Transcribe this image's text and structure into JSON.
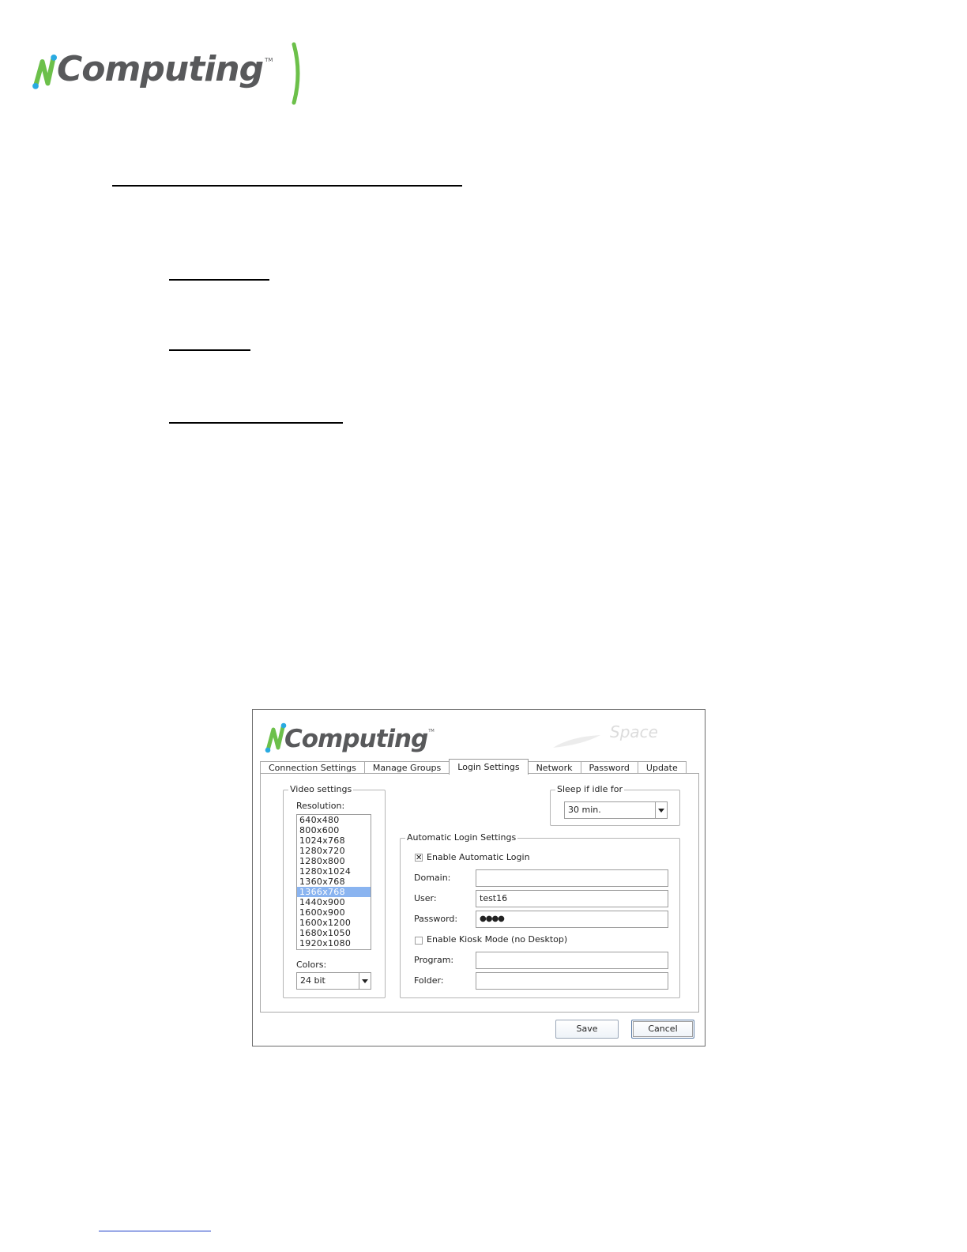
{
  "header": {
    "logo_text": "Computing",
    "logo_tm": "TM"
  },
  "dialog": {
    "logo_text": "Computing",
    "logo_tm": "TM",
    "watermark": "Space",
    "tabs": [
      {
        "label": "Connection Settings",
        "active": false
      },
      {
        "label": "Manage Groups",
        "active": false
      },
      {
        "label": "Login Settings",
        "active": true
      },
      {
        "label": "Network",
        "active": false
      },
      {
        "label": "Password",
        "active": false
      },
      {
        "label": "Update",
        "active": false
      }
    ],
    "video_settings": {
      "title": "Video settings",
      "resolution_label": "Resolution:",
      "resolutions": [
        "640x480",
        "800x600",
        "1024x768",
        "1280x720",
        "1280x800",
        "1280x1024",
        "1360x768",
        "1366x768",
        "1440x900",
        "1600x900",
        "1600x1200",
        "1680x1050",
        "1920x1080"
      ],
      "selected_resolution": "1366x768",
      "colors_label": "Colors:",
      "colors_value": "24 bit"
    },
    "sleep": {
      "title": "Sleep if idle for",
      "value": "30 min."
    },
    "auto_login": {
      "title": "Automatic Login Settings",
      "enable_label": "Enable Automatic Login",
      "enable_checked": true,
      "domain_label": "Domain:",
      "domain_value": "",
      "user_label": "User:",
      "user_value": "test16",
      "password_label": "Password:",
      "password_value": "●●●●",
      "kiosk_label": "Enable Kiosk Mode (no Desktop)",
      "kiosk_checked": false,
      "program_label": "Program:",
      "program_value": "",
      "folder_label": "Folder:",
      "folder_value": ""
    },
    "buttons": {
      "save": "Save",
      "cancel": "Cancel"
    }
  },
  "colors": {
    "brand_green": "#6cc04a",
    "brand_blue": "#29aae1",
    "brand_gray": "#58595b",
    "selection": "#8ab4f0"
  }
}
